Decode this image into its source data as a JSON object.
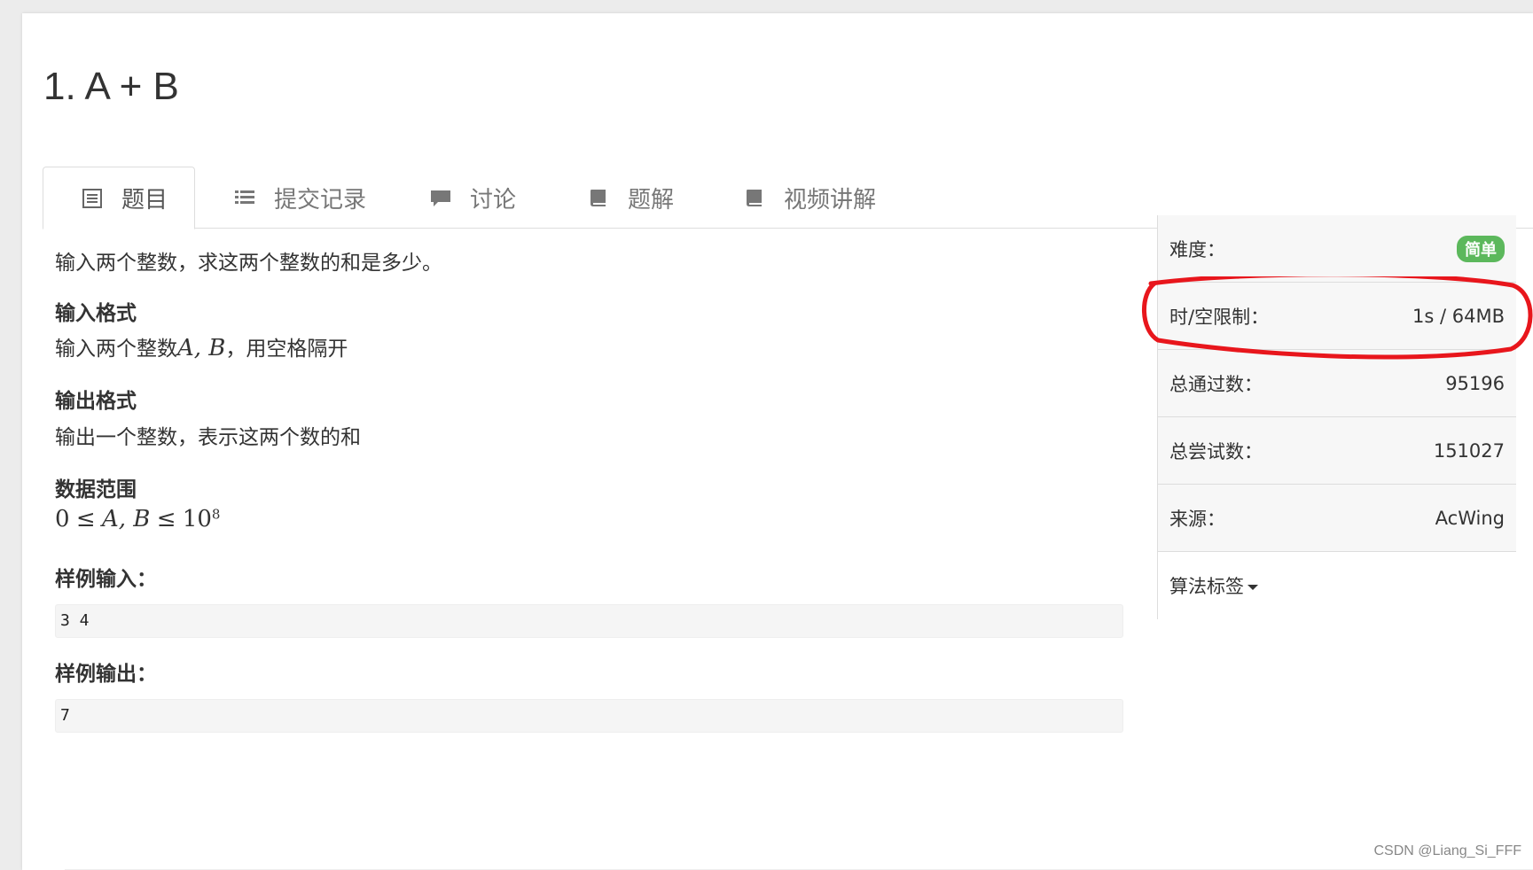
{
  "problem": {
    "title": "1. A + B"
  },
  "tabs": [
    {
      "label": "题目",
      "icon": "document-list-icon",
      "active": true
    },
    {
      "label": "提交记录",
      "icon": "list-icon"
    },
    {
      "label": "讨论",
      "icon": "comment-icon"
    },
    {
      "label": "题解",
      "icon": "book-icon"
    },
    {
      "label": "视频讲解",
      "icon": "book-icon"
    }
  ],
  "description": {
    "intro": "输入两个整数，求这两个整数的和是多少。",
    "input_heading": "输入格式",
    "input_text_prefix": "输入两个整数",
    "input_vars": "A, B",
    "input_text_suffix": "，用空格隔开",
    "output_heading": "输出格式",
    "output_text": "输出一个整数，表示这两个数的和",
    "range_heading": "数据范围",
    "range_zero": "0",
    "range_leq": "≤",
    "range_vars": "A, B",
    "range_base": "10",
    "range_exp": "8",
    "sample_input_heading": "样例输入：",
    "sample_input": "3 4",
    "sample_output_heading": "样例输出：",
    "sample_output": "7"
  },
  "sidebar": {
    "difficulty_label": "难度：",
    "difficulty_value": "简单",
    "difficulty_color": "#5cb85c",
    "limit_label": "时/空限制：",
    "limit_value": "1s / 64MB",
    "passed_label": "总通过数：",
    "passed_value": "95196",
    "attempts_label": "总尝试数：",
    "attempts_value": "151027",
    "source_label": "来源：",
    "source_value": "AcWing",
    "tags_label": "算法标签"
  },
  "annotation_color": "#e8161c",
  "watermark": "CSDN @Liang_Si_FFF"
}
